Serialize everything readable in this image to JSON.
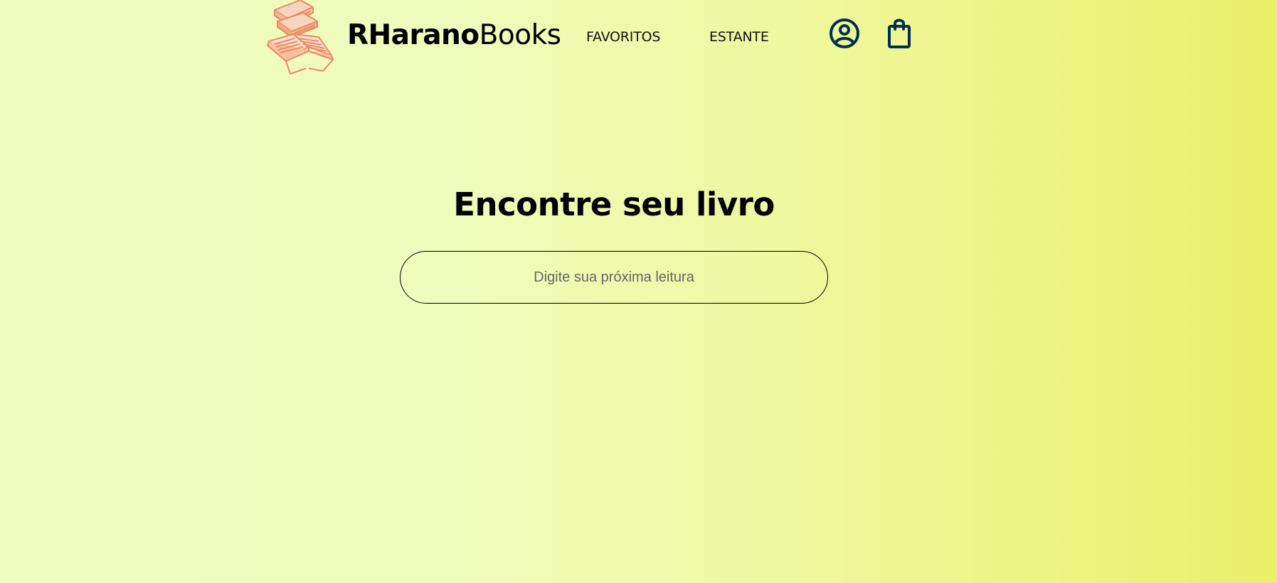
{
  "brand": {
    "strong": "RHarano",
    "light": "Books"
  },
  "nav": {
    "favorites": "FAVORITOS",
    "shelf": "ESTANTE"
  },
  "icons": {
    "logo": "books-stack-icon",
    "profile": "user-circle-icon",
    "bag": "shopping-bag-icon"
  },
  "hero": {
    "title": "Encontre seu livro"
  },
  "search": {
    "placeholder": "Digite sua próxima leitura",
    "value": ""
  },
  "colors": {
    "background_left": "#f1fcc2",
    "background_right": "#eaf06a",
    "icon": "#002f52",
    "logo_accent": "#f0885e"
  }
}
